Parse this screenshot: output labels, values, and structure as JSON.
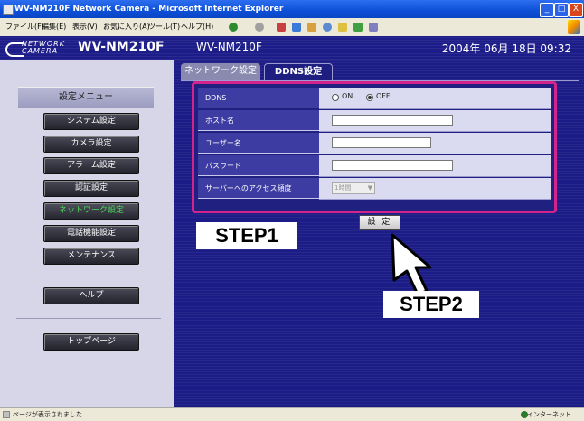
{
  "window": {
    "title": "WV-NM210F Network Camera - Microsoft Internet Explorer",
    "controls": [
      "_",
      "□",
      "X"
    ]
  },
  "menubar": {
    "items": [
      "ファイル(F)",
      "編集(E)",
      "表示(V)",
      "お気に入り(A)",
      "ツール(T)",
      "ヘルプ(H)"
    ]
  },
  "header": {
    "logo_line1": "NETWORK",
    "logo_line2": "CAMERA",
    "logo_model": "WV-NM210F",
    "model": "WV-NM210F",
    "datetime": "2004年 06月 18日 09:32"
  },
  "sidebar": {
    "title": "設定メニュー",
    "buttons": [
      "システム設定",
      "カメラ設定",
      "アラーム設定",
      "認証設定",
      "ネットワーク設定",
      "電話機能設定",
      "メンテナンス"
    ],
    "help": "ヘルプ",
    "top_page": "トップページ",
    "active_color": "#4bd65a"
  },
  "tabs": {
    "network": "ネットワーク設定",
    "ddns": "DDNS設定"
  },
  "form": {
    "ddns_label": "DDNS",
    "ddns_on": "ON",
    "ddns_off": "OFF",
    "ddns_selected": "OFF",
    "host_label": "ホスト名",
    "host_value": "",
    "user_label": "ユーザー名",
    "user_value": "",
    "password_label": "パスワード",
    "password_value": "",
    "access_label": "サーバーへのアクセス頻度",
    "access_value": "1時間",
    "highlight_color": "#d4238a"
  },
  "set_button": "設 定",
  "annotations": {
    "step1": "STEP1",
    "step2": "STEP2"
  },
  "statusbar": {
    "left": "ページが表示されました",
    "right": "インターネット"
  }
}
